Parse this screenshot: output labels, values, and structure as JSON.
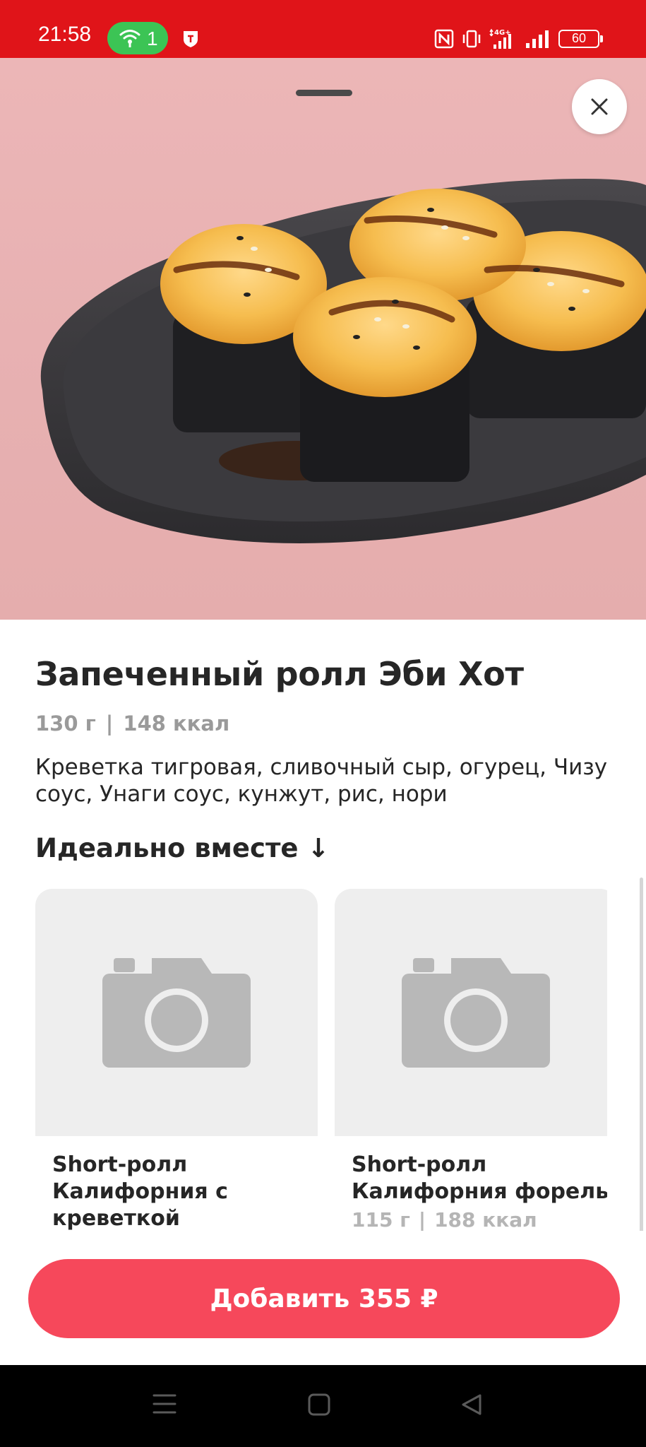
{
  "status_bar": {
    "time": "21:58",
    "hotspot_count": "1",
    "network": "4G+",
    "battery": "60",
    "icons": [
      "hotspot-icon",
      "shield-icon",
      "nfc-icon",
      "vibrate-icon",
      "network-4g-icon",
      "signal-icon",
      "battery-icon"
    ]
  },
  "sheet": {
    "close_icon": "close-icon",
    "image": "baked-sushi-rolls-photo"
  },
  "product": {
    "title": "Запеченный ролл Эби Хот",
    "weight": "130 г",
    "separator": "|",
    "calories": "148 ккал",
    "description": "Креветка тигровая, сливочный сыр, огурец, Чизу соус, Унаги соус, кунжут, рис, нори"
  },
  "together": {
    "heading": "Идеально вместе ↓",
    "items": [
      {
        "name": "Short-ролл Калифорния с креветкой",
        "weight": "",
        "calories": "",
        "image": "camera-placeholder-icon"
      },
      {
        "name": "Short-ролл Калифорния форель",
        "weight": "115 г",
        "calories": "188 ккал",
        "image": "camera-placeholder-icon"
      }
    ]
  },
  "action": {
    "add_label": "Добавить 355 ₽"
  },
  "colors": {
    "status_bar": "#e01419",
    "accent_button": "#f6485b",
    "hero_background": "#ecb6b7",
    "hotspot_badge": "#3cc455"
  },
  "nav_bar": {
    "icons": [
      "menu-icon",
      "home-icon",
      "back-icon"
    ]
  }
}
